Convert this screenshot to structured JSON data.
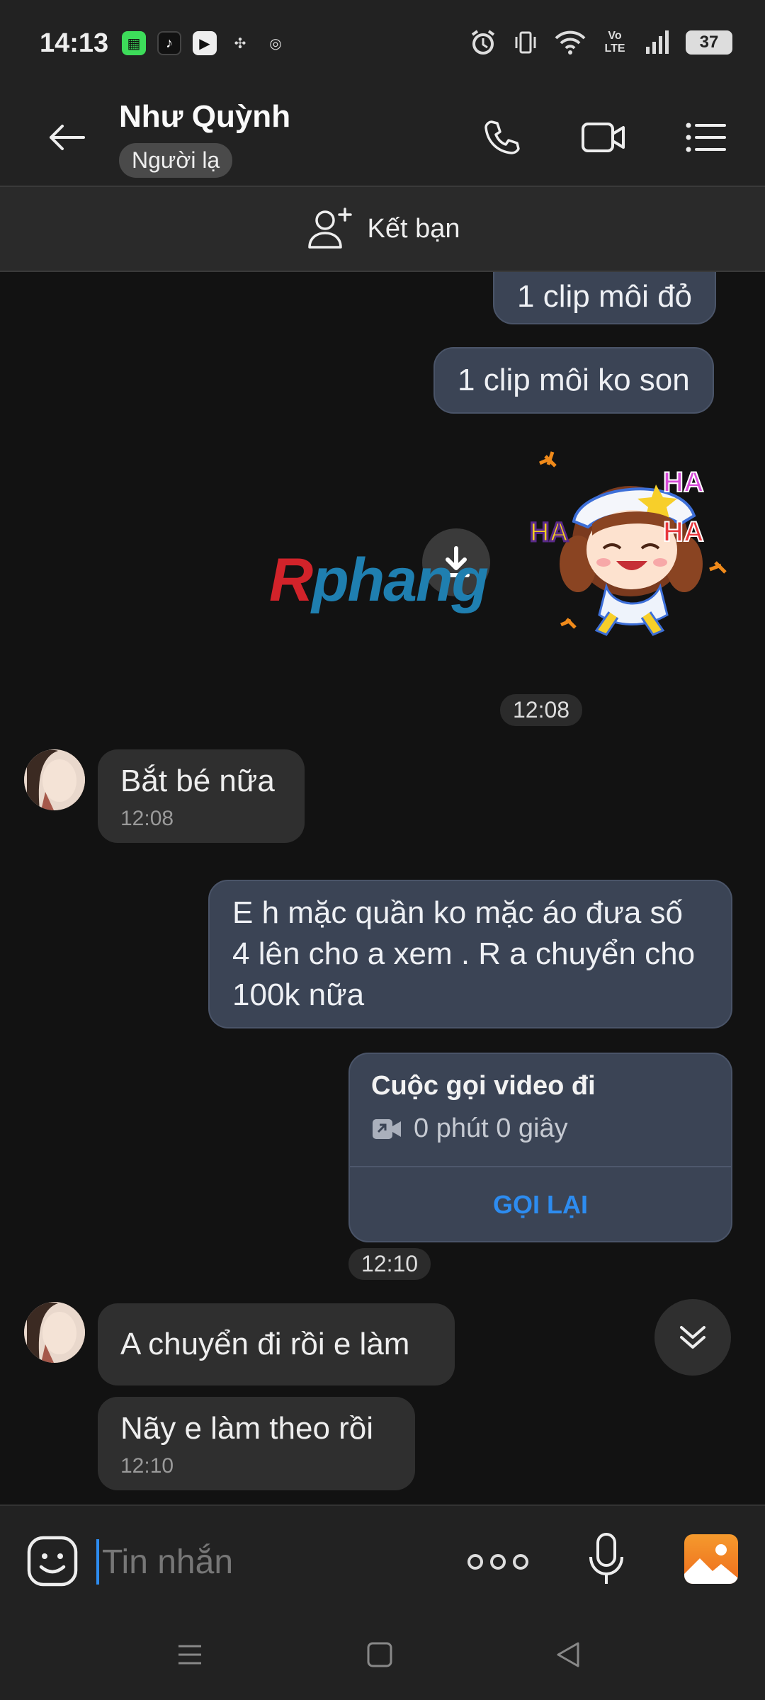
{
  "status_bar": {
    "time": "14:13",
    "battery": "37",
    "network_label": "Vo LTE"
  },
  "header": {
    "contact_name": "Như Quỳnh",
    "badge": "Người lạ"
  },
  "add_friend": {
    "label": "Kết bạn"
  },
  "messages": {
    "out_1": "1 clip môi đỏ",
    "out_2": "1 clip môi ko son",
    "sticker_text": "HA HA HA",
    "ts_1": "12:08",
    "in_1": "Bắt bé nữa",
    "in_1_time": "12:08",
    "out_3": "E h mặc quần ko mặc áo đưa số 4 lên cho a xem . R a chuyển cho 100k nữa",
    "call_title": "Cuộc gọi video đi",
    "call_duration": "0 phút 0 giây",
    "call_back": "GỌI LẠI",
    "ts_2": "12:10",
    "in_2": "A chuyển đi rồi e làm",
    "in_3": "Nãy e làm theo rồi",
    "in_3_time": "12:10"
  },
  "watermark": {
    "first": "R",
    "rest": "phang"
  },
  "input": {
    "placeholder": "Tin nhắn"
  },
  "colors": {
    "accent": "#2d8cf0",
    "outgoing_bubble": "#3b4455",
    "incoming_bubble": "#2f2f2f",
    "background": "#121212"
  }
}
